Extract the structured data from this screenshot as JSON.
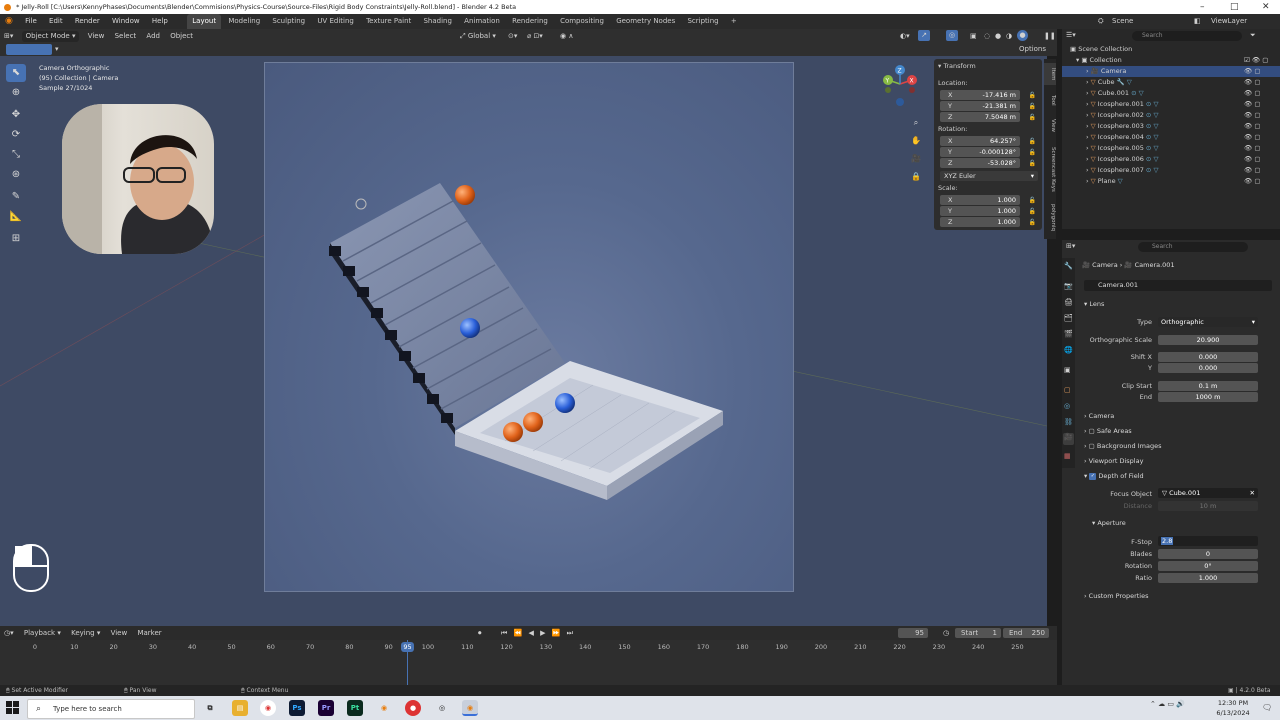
{
  "window": {
    "title": "* Jelly-Roll [C:\\Users\\KennyPhases\\Documents\\Blender\\Commisions\\Physics-Course\\Source-Files\\Rigid Body Constraints\\Jelly-Roll.blend] - Blender 4.2 Beta"
  },
  "menu": {
    "items": [
      "File",
      "Edit",
      "Render",
      "Window",
      "Help"
    ],
    "workspaces": [
      "Layout",
      "Modeling",
      "Sculpting",
      "UV Editing",
      "Texture Paint",
      "Shading",
      "Animation",
      "Rendering",
      "Compositing",
      "Geometry Nodes",
      "Scripting"
    ],
    "scene": "Scene",
    "view_layer": "ViewLayer"
  },
  "viewport_header": {
    "mode": "Object Mode",
    "view": "View",
    "select": "Select",
    "add": "Add",
    "object": "Object",
    "orientation": "Global",
    "options": "Options"
  },
  "viewport": {
    "info_line1": "Camera Orthographic",
    "info_line2": "(95) Collection | Camera",
    "info_line3": "Sample 27/1024"
  },
  "transform": {
    "title": "Transform",
    "location_label": "Location:",
    "location": {
      "x": "-17.416 m",
      "y": "-21.381 m",
      "z": "7.5048 m"
    },
    "rotation_label": "Rotation:",
    "rotation": {
      "x": "64.257°",
      "y": "-0.000128°",
      "z": "-53.028°"
    },
    "rotation_mode": "XYZ Euler",
    "scale_label": "Scale:",
    "scale": {
      "x": "1.000",
      "y": "1.000",
      "z": "1.000"
    }
  },
  "side_tabs": [
    "Item",
    "Tool",
    "View",
    "Screencast Keys",
    "polygoniq"
  ],
  "outliner": {
    "search_placeholder": "Search",
    "root": "Scene Collection",
    "collection": "Collection",
    "items": [
      "Camera",
      "Cube",
      "Cube.001",
      "Icosphere.001",
      "Icosphere.002",
      "Icosphere.003",
      "Icosphere.004",
      "Icosphere.005",
      "Icosphere.006",
      "Icosphere.007",
      "Plane"
    ]
  },
  "properties": {
    "search_placeholder": "Search",
    "breadcrumb_object": "Camera",
    "breadcrumb_data": "Camera.001",
    "datablock": "Camera.001",
    "lens_section": "Lens",
    "type_label": "Type",
    "type_value": "Orthographic",
    "ortho_scale_label": "Orthographic Scale",
    "ortho_scale": "20.900",
    "shift_x_label": "Shift X",
    "shift_x": "0.000",
    "shift_y_label": "Y",
    "shift_y": "0.000",
    "clip_start_label": "Clip Start",
    "clip_start": "0.1 m",
    "clip_end_label": "End",
    "clip_end": "1000 m",
    "camera_section": "Camera",
    "safe_areas": "Safe Areas",
    "background_images": "Background Images",
    "viewport_display": "Viewport Display",
    "dof_section": "Depth of Field",
    "focus_object_label": "Focus Object",
    "focus_object": "Cube.001",
    "distance_label": "Distance",
    "distance": "10 m",
    "aperture_section": "Aperture",
    "fstop_label": "F-Stop",
    "fstop": "2.8",
    "blades_label": "Blades",
    "blades": "0",
    "rotation_label": "Rotation",
    "rotation": "0°",
    "ratio_label": "Ratio",
    "ratio": "1.000",
    "custom_properties": "Custom Properties"
  },
  "timeline": {
    "menus": [
      "Playback",
      "Keying",
      "View",
      "Marker"
    ],
    "current_frame": "95",
    "start_label": "Start",
    "start": "1",
    "end_label": "End",
    "end": "250",
    "ticks": [
      "0",
      "10",
      "20",
      "30",
      "40",
      "50",
      "60",
      "70",
      "80",
      "90",
      "100",
      "110",
      "120",
      "130",
      "140",
      "150",
      "160",
      "170",
      "180",
      "190",
      "200",
      "210",
      "220",
      "230",
      "240",
      "250"
    ]
  },
  "status_bar": {
    "left": "Set Active Modifier",
    "middle": "Pan View",
    "right": "Context Menu",
    "version": "4.2.0 Beta"
  },
  "taskbar": {
    "search_placeholder": "Type here to search",
    "time": "12:30 PM",
    "date": "6/13/2024",
    "apps": [
      "Ps",
      "Pr",
      "Pt"
    ]
  },
  "colors": {
    "accent": "#4772b3",
    "selection": "#334d80",
    "orange_sphere": "#e0621a",
    "blue_sphere": "#2a5fd8",
    "blender_orange": "#e87d0d"
  }
}
